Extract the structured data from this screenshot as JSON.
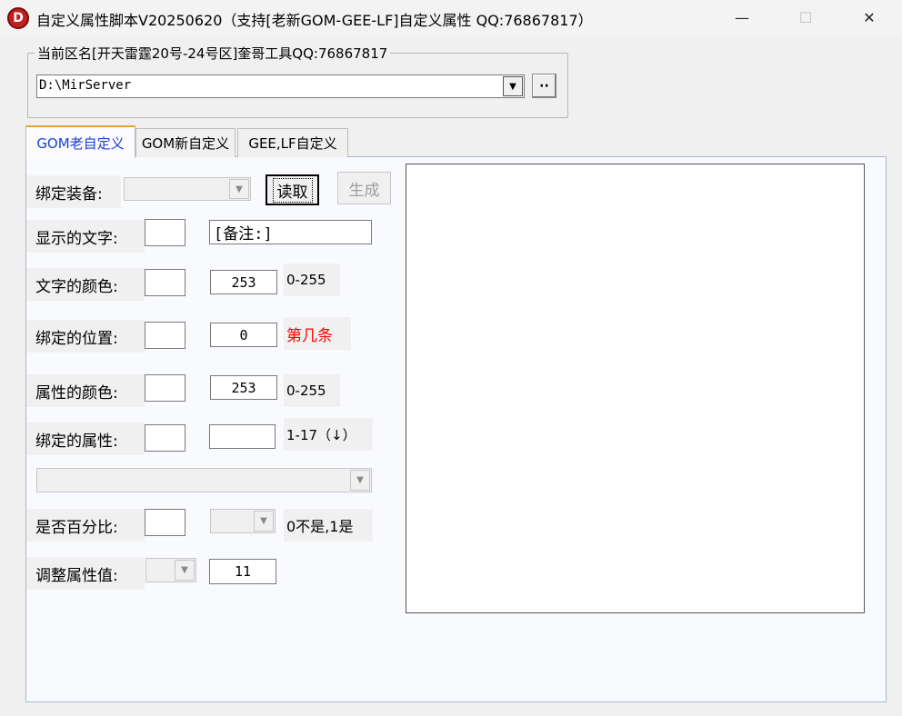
{
  "window": {
    "app_icon_letter": "D",
    "title": "自定义属性脚本V20250620（支持[老新GOM-GEE-LF]自定义属性 QQ:76867817）",
    "min_glyph": "—",
    "max_glyph": "☐",
    "close_glyph": "✕"
  },
  "server": {
    "legend": "当前区名[开天雷霆20号-24号区]奎哥工具QQ:76867817",
    "path_value": "D:\\MirServer",
    "browse_label": "··"
  },
  "tabs": [
    {
      "label": "GOM老自定义"
    },
    {
      "label": "GOM新自定义"
    },
    {
      "label": "GEE,LF自定义"
    }
  ],
  "form": {
    "bind_equip_label": "绑定装备:",
    "read_button": "读取",
    "generate_button": "生成",
    "display_text_label": "显示的文字:",
    "display_text_value": "[备注:]",
    "text_color_label": "文字的颜色:",
    "text_color_value": "253",
    "text_color_hint": "0-255",
    "bind_pos_label": "绑定的位置:",
    "bind_pos_value": "0",
    "bind_pos_hint": "第几条",
    "attr_color_label": "属性的颜色:",
    "attr_color_value": "253",
    "attr_color_hint": "0-255",
    "bind_attr_label": "绑定的属性:",
    "bind_attr_value": "",
    "bind_attr_hint": "1-17（↓）",
    "percent_label": "是否百分比:",
    "percent_hint": "0不是,1是",
    "adjust_label": "调整属性值:",
    "adjust_value": "11"
  },
  "colors": {
    "active_tab_text": "#1b3fd0",
    "active_tab_accent": "#e6a52c",
    "hint_red": "#ff0000",
    "disabled_text": "#9e9e9e"
  }
}
